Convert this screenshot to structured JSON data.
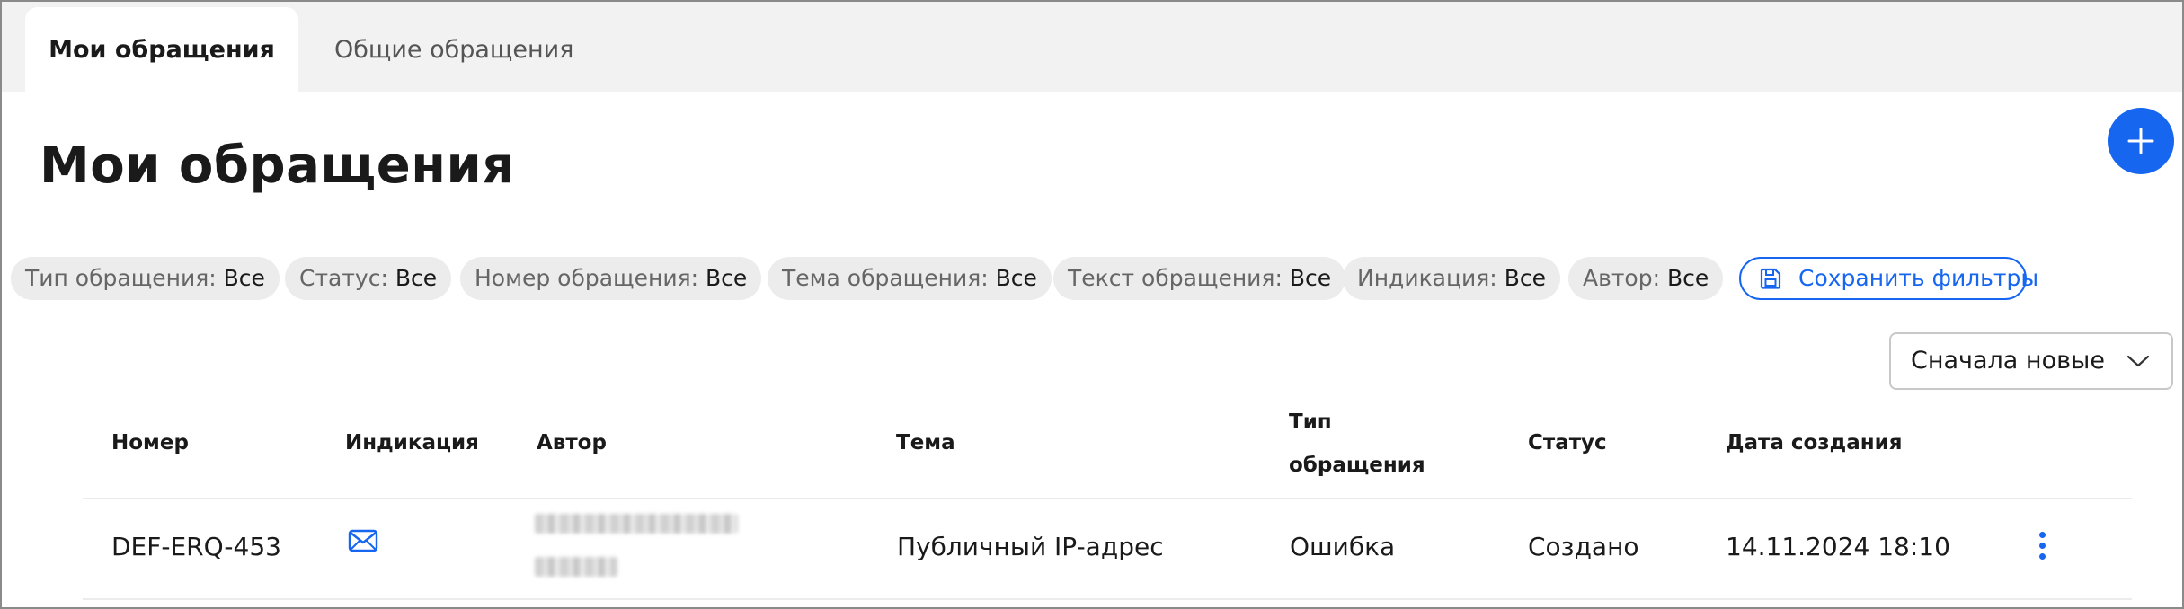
{
  "tabs": [
    {
      "label": "Мои обращения",
      "active": true
    },
    {
      "label": "Общие обращения",
      "active": false
    }
  ],
  "page_title": "Мои обращения",
  "filters": [
    {
      "label": "Тип обращения:",
      "value": "Все"
    },
    {
      "label": "Статус:",
      "value": "Все"
    },
    {
      "label": "Номер обращения:",
      "value": "Все"
    },
    {
      "label": "Тема обращения:",
      "value": "Все"
    },
    {
      "label": "Текст обращения:",
      "value": "Все"
    },
    {
      "label": "Индикация:",
      "value": "Все"
    },
    {
      "label": "Автор:",
      "value": "Все"
    }
  ],
  "save_filters_label": "Сохранить фильтры",
  "sort": {
    "selected": "Сначала новые"
  },
  "table": {
    "columns": {
      "number": "Номер",
      "indication": "Индикация",
      "author": "Автор",
      "topic": "Тема",
      "type_line1": "Тип",
      "type_line2": "обращения",
      "status": "Статус",
      "created": "Дата создания"
    },
    "rows": [
      {
        "number": "DEF-ERQ-453",
        "indication_icon": "envelope-icon",
        "author_redacted": true,
        "topic": "Публичный IP-адрес",
        "type": "Ошибка",
        "status": "Создано",
        "created": "14.11.2024 18:10"
      }
    ]
  },
  "colors": {
    "accent": "#1666f0",
    "chip_bg": "#ececec",
    "tabbar_bg": "#f2f2f2"
  }
}
